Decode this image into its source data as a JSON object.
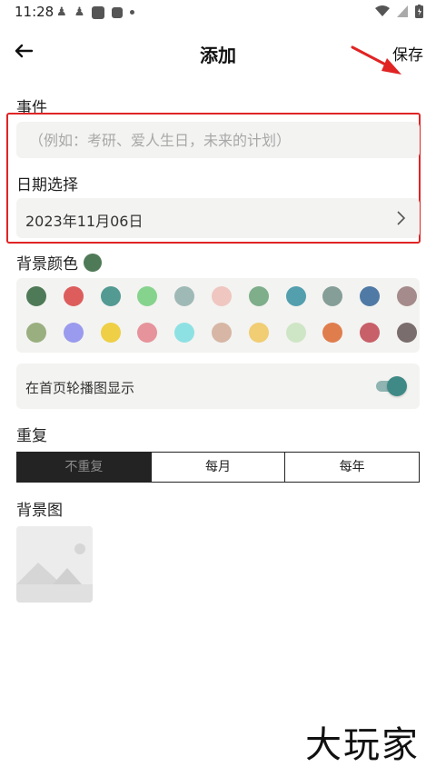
{
  "status_bar": {
    "time": "11:28"
  },
  "header": {
    "title": "添加",
    "save_label": "保存"
  },
  "event": {
    "label": "事件",
    "placeholder": "（例如：考研、爱人生日，未来的计划）"
  },
  "date": {
    "label": "日期选择",
    "value": "2023年11月06日"
  },
  "background_color": {
    "label": "背景颜色",
    "selected": "#4f7a57",
    "colors": [
      "#4f7a57",
      "#dd5d5d",
      "#539a93",
      "#86d38e",
      "#9fb9b6",
      "#efc6c0",
      "#7fae8a",
      "#539fae",
      "#859e98",
      "#4f7aa5",
      "#a58b8b",
      "#9aaf80",
      "#9a9aee",
      "#eecf45",
      "#e6939b",
      "#8ee1e3",
      "#d7b6a6",
      "#f1cd73",
      "#cfe6c6",
      "#e07d4d",
      "#c76068",
      "#7a6d6d"
    ]
  },
  "carousel": {
    "label": "在首页轮播图显示",
    "enabled": true
  },
  "repeat": {
    "label": "重复",
    "options": [
      "不重复",
      "每月",
      "每年"
    ],
    "selected": "不重复"
  },
  "background_image": {
    "label": "背景图"
  },
  "watermark": "大玩家"
}
